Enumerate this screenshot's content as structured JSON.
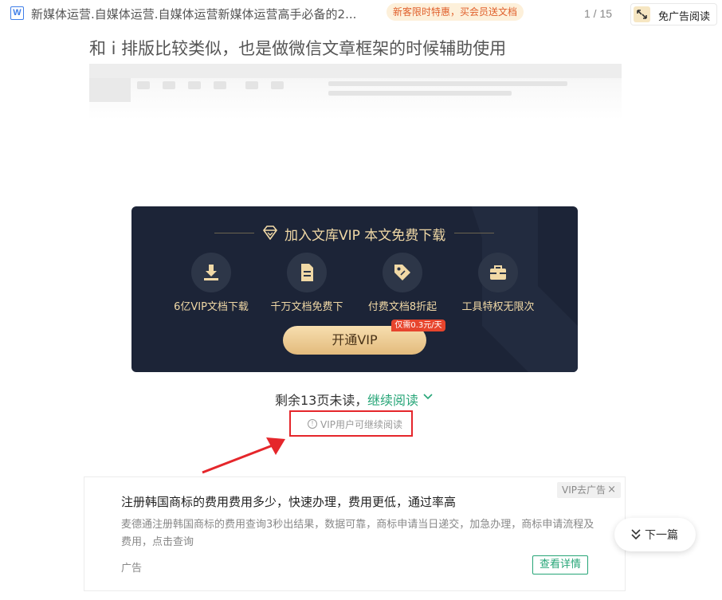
{
  "topbar": {
    "doc_icon": "W",
    "title": "新媒体运营.自媒体运营.自媒体运营新媒体运营高手必备的2...",
    "promo": "新客限时特惠，买会员送文档",
    "page_indicator": "1 / 15",
    "adfree_label": "免广告阅读"
  },
  "article": {
    "text": "和 i 排版比较类似，也是做微信文章框架的时候辅助使用"
  },
  "vip": {
    "title": "加入文库VIP 本文免费下载",
    "features": [
      {
        "label": "6亿VIP文档下载",
        "icon": "download-icon"
      },
      {
        "label": "千万文档免费下",
        "icon": "document-icon"
      },
      {
        "label": "付费文档8折起",
        "icon": "tag-icon"
      },
      {
        "label": "工具特权无限次",
        "icon": "toolbox-icon"
      }
    ],
    "button_label": "开通VIP",
    "price_tag": "仅需0.3元/天",
    "colors": {
      "card_bg": "#1c2437",
      "gold": "#f1d9a6"
    }
  },
  "reading": {
    "remaining": "剩余13页未读，",
    "continue_label": "继续阅读",
    "vip_notice": "VIP用户可继续阅读"
  },
  "ad": {
    "title": "注册韩国商标的费用费用多少，快速办理，费用更低，通过率高",
    "description": "麦德通注册韩国商标的费用查询3秒出结果，数据可靠，商标申请当日递交，加急办理，商标申请流程及费用，点击查询",
    "label": "广告",
    "remove_label": "VIP去广告",
    "detail_button": "查看详情"
  },
  "next_button": "下一篇",
  "accent_color": "#26a577"
}
